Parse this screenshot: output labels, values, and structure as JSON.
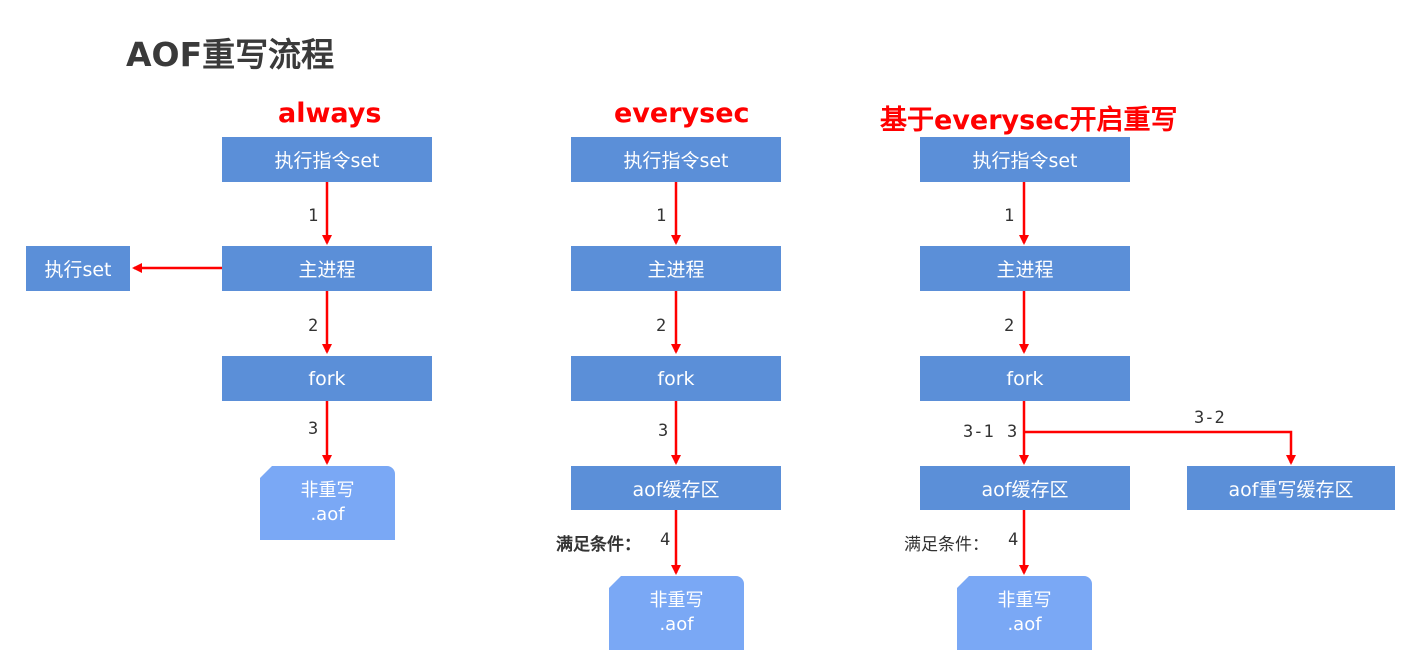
{
  "title": "AOF重写流程",
  "columns": [
    {
      "heading": "always",
      "cmd_box": "执行指令set",
      "main_box": "主进程",
      "fork_box": "fork",
      "side_box": "执行set",
      "doc_line1": "非重写",
      "doc_line2": ".aof",
      "step1": "1",
      "step2": "2",
      "step3": "3"
    },
    {
      "heading": "everysec",
      "cmd_box": "执行指令set",
      "main_box": "主进程",
      "fork_box": "fork",
      "buffer_box": "aof缓存区",
      "condition_label": "满足条件：",
      "doc_line1": "非重写",
      "doc_line2": ".aof",
      "step1": "1",
      "step2": "2",
      "step3": "3",
      "step4": "4"
    },
    {
      "heading": "基于everysec开启重写",
      "cmd_box": "执行指令set",
      "main_box": "主进程",
      "fork_box": "fork",
      "buffer_box": "aof缓存区",
      "rewrite_buffer_box": "aof重写缓存区",
      "condition_label": "满足条件：",
      "doc_line1": "非重写",
      "doc_line2": ".aof",
      "step1": "1",
      "step2": "2",
      "step3_1": "3-1",
      "step3": "3",
      "step3_2": "3-2",
      "step4": "4"
    }
  ],
  "colors": {
    "box": "#5b8fd8",
    "doc": "#7aa8f5",
    "arrow": "#ff0000",
    "heading": "#ff0000"
  }
}
